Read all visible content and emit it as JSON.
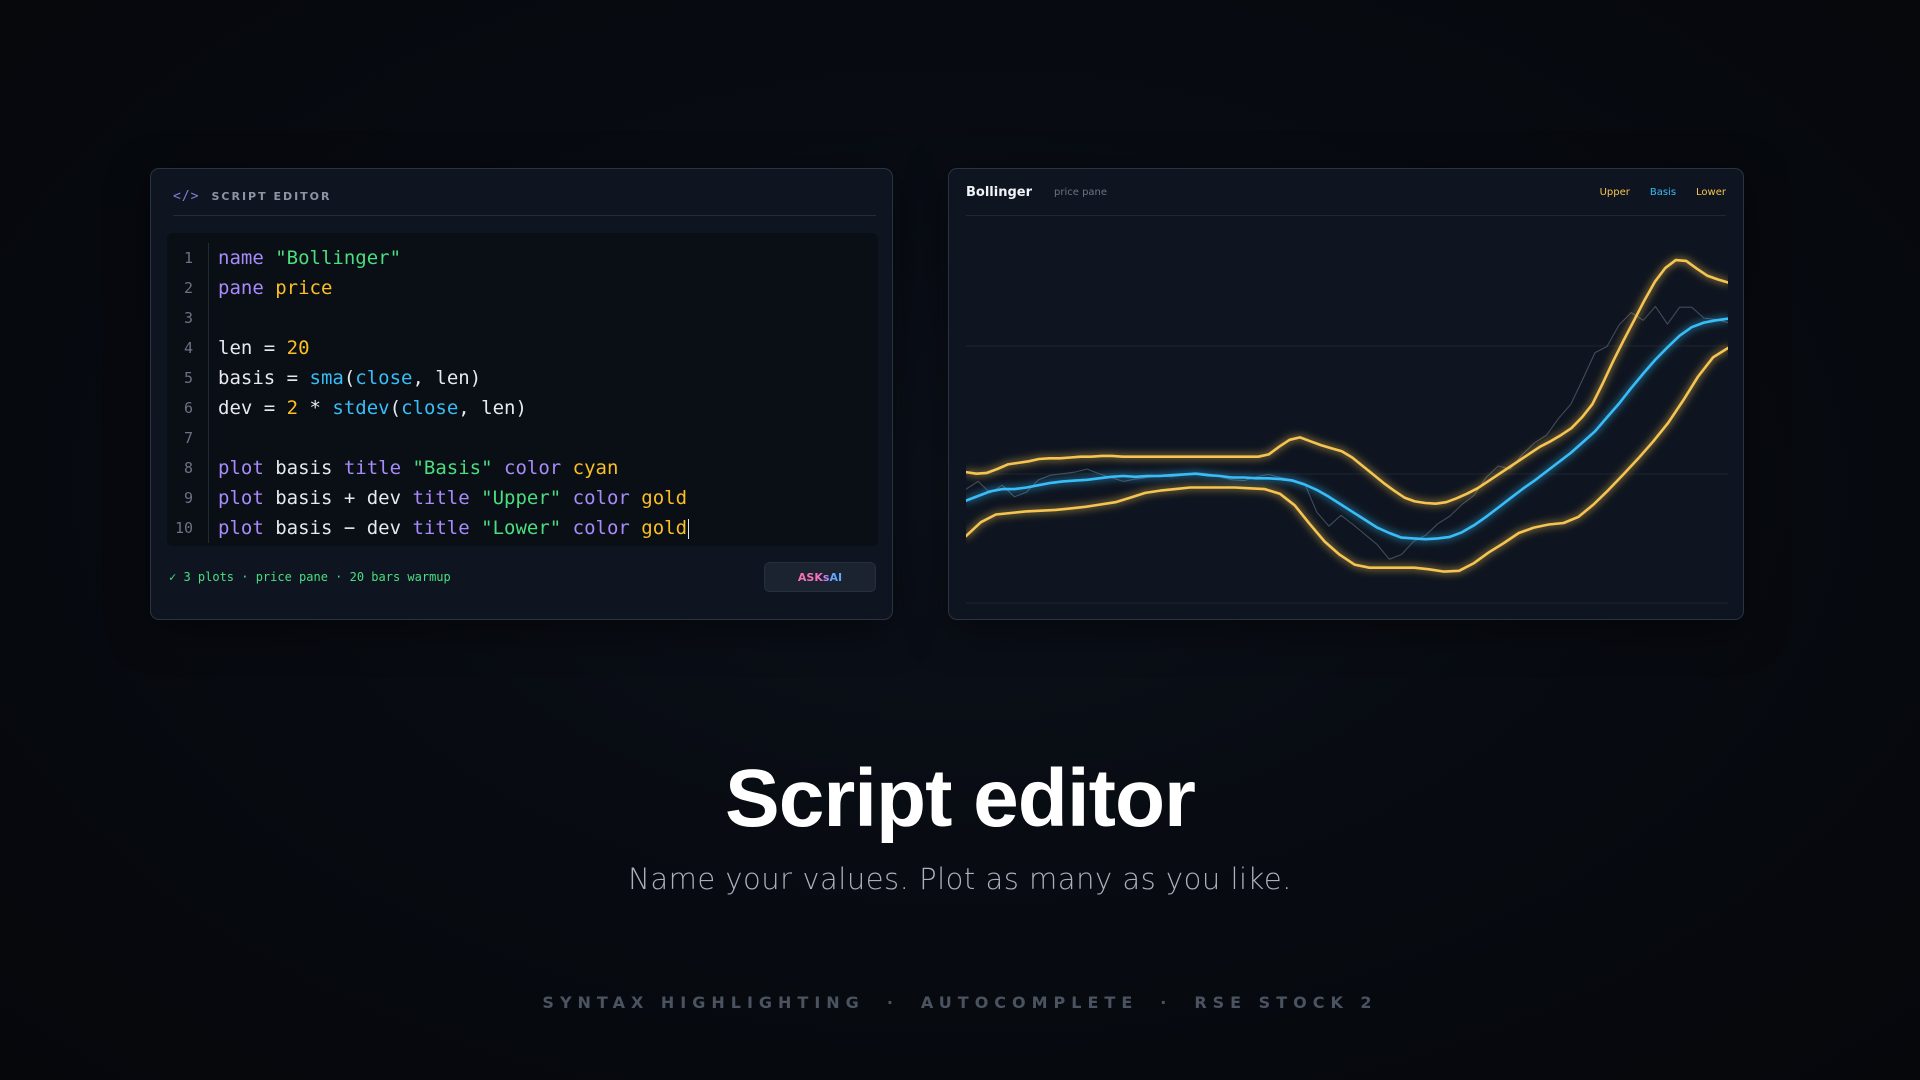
{
  "editor": {
    "icon": "code-icon",
    "icon_glyph": "</>",
    "title": "SCRIPT EDITOR",
    "lines": [
      {
        "n": "1"
      },
      {
        "n": "2"
      },
      {
        "n": "3"
      },
      {
        "n": "4"
      },
      {
        "n": "5"
      },
      {
        "n": "6"
      },
      {
        "n": "7"
      },
      {
        "n": "8"
      },
      {
        "n": "9"
      },
      {
        "n": "10"
      }
    ],
    "code": {
      "l1": {
        "kw": "name",
        "str": "\"Bollinger\""
      },
      "l2": {
        "kw": "pane",
        "val": "price"
      },
      "l4": {
        "a": "len = ",
        "num": "20"
      },
      "l5": {
        "a": "basis = ",
        "fn": "sma",
        "b": "(",
        "fn2": "close",
        "c": ", len)"
      },
      "l6": {
        "a": "dev = ",
        "num": "2",
        "b": " * ",
        "fn": "stdev",
        "c": "(",
        "fn2": "close",
        "d": ", len)"
      },
      "l8": {
        "kw": "plot",
        "a": " basis ",
        "kw2": "title",
        "str": " \"Basis\" ",
        "kw3": "color",
        "val": " cyan"
      },
      "l9": {
        "kw": "plot",
        "a": " basis + dev ",
        "kw2": "title",
        "str": " \"Upper\" ",
        "kw3": "color",
        "val": " gold"
      },
      "l10": {
        "kw": "plot",
        "a": " basis − dev ",
        "kw2": "title",
        "str": " \"Lower\" ",
        "kw3": "color",
        "val": " gold"
      }
    },
    "status": "✓  3 plots · price pane · 20 bars warmup",
    "ask_button": {
      "a": "ASK ",
      "b": "s",
      "c": "AI"
    }
  },
  "chart": {
    "title": "Bollinger",
    "subtitle": "price pane",
    "legend": {
      "upper": "Upper",
      "basis": "Basis",
      "lower": "Lower"
    },
    "colors": {
      "upper": "#f5c451",
      "basis": "#38bdf8",
      "lower": "#f5c451",
      "price": "#4b5566"
    }
  },
  "chart_data": {
    "type": "line",
    "title": "Bollinger",
    "x": [
      0,
      1,
      2,
      3,
      4,
      5,
      6,
      7,
      8,
      9,
      10,
      11,
      12,
      13,
      14,
      15,
      16,
      17,
      18,
      19,
      20,
      21,
      22,
      23,
      24,
      25,
      26,
      27,
      28,
      29,
      30,
      31,
      32,
      33,
      34,
      35,
      36,
      37,
      38,
      39,
      40,
      41,
      42,
      43,
      44,
      45,
      46,
      47,
      48,
      49,
      50,
      51,
      52,
      53,
      54,
      55,
      56,
      57,
      58,
      59,
      60,
      61,
      62,
      63,
      64,
      65,
      66,
      67,
      68,
      69,
      70,
      71,
      72,
      73,
      74,
      75,
      76,
      77,
      78,
      79,
      80,
      81,
      82,
      83,
      84,
      85,
      86,
      87,
      88,
      89,
      90,
      91,
      92,
      93,
      94,
      95,
      96,
      97,
      98,
      99,
      100,
      101,
      102,
      103,
      104,
      105,
      106,
      107,
      108,
      109,
      110,
      111,
      112,
      113,
      114,
      115,
      116,
      117,
      118,
      119
    ],
    "series": [
      {
        "name": "Upper",
        "values": [
          44.2,
          44.0,
          44.1,
          44.6,
          45.2,
          45.4,
          45.6,
          45.9,
          46.0,
          46.0,
          46.1,
          46.2,
          46.2,
          46.3,
          46.3,
          46.2,
          46.2,
          46.2,
          46.2,
          46.2,
          46.2,
          46.2,
          46.2,
          46.2,
          46.2,
          46.2,
          46.2,
          46.2,
          46.2,
          46.5,
          47.5,
          48.4,
          48.7,
          48.2,
          47.7,
          47.3,
          46.9,
          46.1,
          45.0,
          43.9,
          42.8,
          41.8,
          40.9,
          40.4,
          40.2,
          40.1,
          40.3,
          40.8,
          41.4,
          42.1,
          43.0,
          43.9,
          44.8,
          45.7,
          46.6,
          47.5,
          48.2,
          49.0,
          49.9,
          51.3,
          53.0,
          55.7,
          58.6,
          61.3,
          63.9,
          66.5,
          68.9,
          70.7,
          71.7,
          71.6,
          70.6,
          69.7,
          69.2,
          68.8
        ]
      },
      {
        "name": "Basis",
        "values": [
          40.5,
          41.1,
          41.7,
          42.0,
          42.0,
          42.2,
          42.5,
          42.8,
          43.0,
          43.1,
          43.2,
          43.4,
          43.6,
          43.7,
          43.6,
          43.7,
          43.7,
          43.8,
          43.9,
          44.0,
          43.8,
          43.7,
          43.5,
          43.5,
          43.4,
          43.4,
          43.3,
          43.1,
          42.6,
          41.9,
          41.0,
          40.0,
          39.0,
          38.0,
          37.0,
          36.3,
          35.7,
          35.6,
          35.5,
          35.6,
          35.8,
          36.4,
          37.3,
          38.4,
          39.6,
          40.8,
          42.0,
          43.1,
          44.3,
          45.5,
          46.7,
          48.1,
          49.5,
          51.3,
          53.1,
          55.1,
          57.0,
          58.8,
          60.4,
          61.9,
          63.0,
          63.6,
          63.9,
          64.1
        ]
      },
      {
        "name": "Lower",
        "values": [
          35.9,
          37.7,
          38.7,
          38.9,
          39.1,
          39.2,
          39.3,
          39.5,
          39.7,
          40.0,
          40.3,
          40.9,
          41.5,
          41.8,
          42.0,
          42.2,
          42.2,
          42.2,
          42.2,
          42.1,
          42.0,
          41.4,
          39.9,
          37.5,
          35.2,
          33.5,
          32.2,
          31.8,
          31.8,
          31.8,
          31.8,
          31.6,
          31.3,
          31.4,
          32.4,
          33.8,
          35.0,
          36.3,
          37.0,
          37.4,
          37.6,
          38.4,
          40.0,
          41.9,
          43.9,
          46.0,
          48.2,
          50.6,
          53.5,
          56.6,
          59.1,
          60.3
        ]
      },
      {
        "name": "",
        "values": [
          42.0,
          43.0,
          41.5,
          42.5,
          41.0,
          41.6,
          43.2,
          43.8,
          44.0,
          44.2,
          44.6,
          44.0,
          43.5,
          43.0,
          43.3,
          43.5,
          43.7,
          43.6,
          43.8,
          44.1,
          44.0,
          43.6,
          43.2,
          43.1,
          43.6,
          43.9,
          43.5,
          43.2,
          42.7,
          39.0,
          37.2,
          38.6,
          37.4,
          36.1,
          34.8,
          32.9,
          33.5,
          35.2,
          36.0,
          37.5,
          38.5,
          40.0,
          41.2,
          43.5,
          45.0,
          44.6,
          46.5,
          48.0,
          49.0,
          51.2,
          53.0,
          56.3,
          59.7,
          60.5,
          63.3,
          64.9,
          63.9,
          65.7,
          63.4,
          65.6,
          65.6,
          64.2,
          64.0,
          63.6
        ]
      }
    ],
    "ylim": [
      28,
      76
    ],
    "grid": true
  },
  "headline": "Script editor",
  "subline": "Name your values. Plot as many as you like.",
  "features": [
    "SYNTAX HIGHLIGHTING",
    "AUTOCOMPLETE",
    "RSE STOCK 2"
  ]
}
